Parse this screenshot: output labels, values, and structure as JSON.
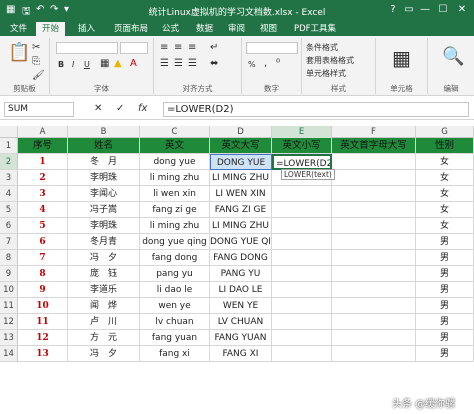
{
  "window": {
    "title": "统计Linux虚拟机的学习文档数.xlsx - Excel",
    "buttons": [
      "?",
      "▭",
      "—",
      "☐",
      "✕"
    ]
  },
  "tabs": [
    "文件",
    "开始",
    "插入",
    "页面布局",
    "公式",
    "数据",
    "审阅",
    "视图",
    "PDF工具集"
  ],
  "ribbon": {
    "groups": [
      "剪贴板",
      "字体",
      "对齐方式",
      "数字",
      "样式",
      "单元格",
      "编辑"
    ],
    "style_items": [
      "条件格式",
      "套用表格格式",
      "单元格样式"
    ],
    "font_buttons": [
      "B",
      "I",
      "U"
    ],
    "number_format": "%"
  },
  "formula_bar": {
    "name_box": "SUM",
    "formula": "=LOWER(D2)",
    "cancel": "✕",
    "enter": "✓",
    "fx": "fx"
  },
  "tooltip": "LOWER(text)",
  "columns": [
    "A",
    "B",
    "C",
    "D",
    "E",
    "F",
    "G"
  ],
  "header_row": [
    "序号",
    "姓名",
    "英文",
    "英文大写",
    "英文小写",
    "英文首字母大写",
    "性别"
  ],
  "rows": [
    {
      "num": "1",
      "name": "冬　月",
      "en": "dong yue",
      "upper": "DONG YUE",
      "lower": "=LOWER(D2)",
      "gender": "女"
    },
    {
      "num": "2",
      "name": "李明珠",
      "en": "li ming zhu",
      "upper": "LI MING ZHU",
      "lower": "",
      "gender": "女"
    },
    {
      "num": "3",
      "name": "李闻心",
      "en": "li wen xin",
      "upper": "LI WEN XIN",
      "lower": "",
      "gender": "女"
    },
    {
      "num": "4",
      "name": "冯子嵩",
      "en": "fang zi ge",
      "upper": "FANG ZI GE",
      "lower": "",
      "gender": "女"
    },
    {
      "num": "5",
      "name": "李明珠",
      "en": "li ming zhu",
      "upper": "LI MING ZHU",
      "lower": "",
      "gender": "女"
    },
    {
      "num": "6",
      "name": "冬月青",
      "en": "dong yue qing",
      "upper": "DONG YUE QING",
      "lower": "",
      "gender": "男"
    },
    {
      "num": "7",
      "name": "冯　夕",
      "en": "fang dong",
      "upper": "FANG DONG",
      "lower": "",
      "gender": "男"
    },
    {
      "num": "8",
      "name": "庞　钰",
      "en": "pang yu",
      "upper": "PANG YU",
      "lower": "",
      "gender": "男"
    },
    {
      "num": "9",
      "name": "李道乐",
      "en": "li dao le",
      "upper": "LI DAO LE",
      "lower": "",
      "gender": "男"
    },
    {
      "num": "10",
      "name": "闻　烨",
      "en": "wen ye",
      "upper": "WEN YE",
      "lower": "",
      "gender": "男"
    },
    {
      "num": "11",
      "name": "卢　川",
      "en": "lv chuan",
      "upper": "LV CHUAN",
      "lower": "",
      "gender": "男"
    },
    {
      "num": "12",
      "name": "方　元",
      "en": "fang yuan",
      "upper": "FANG YUAN",
      "lower": "",
      "gender": "男"
    },
    {
      "num": "13",
      "name": "冯　夕",
      "en": "fang xi",
      "upper": "FANG XI",
      "lower": "",
      "gender": "男"
    }
  ],
  "watermark": "头条 @缓你骡"
}
